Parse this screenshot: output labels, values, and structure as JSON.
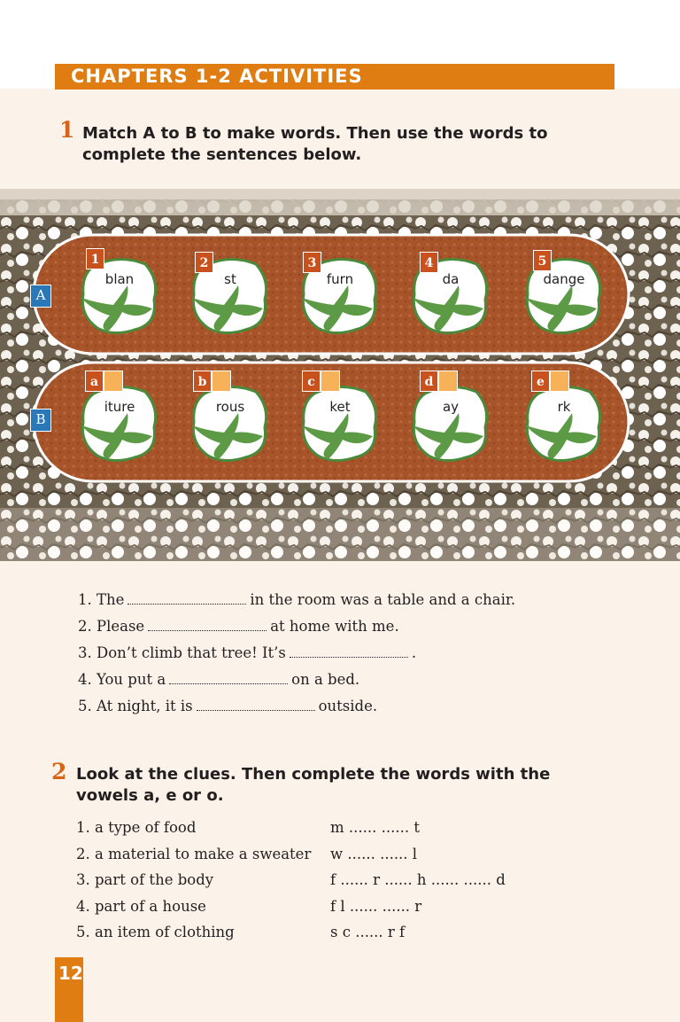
{
  "header": {
    "title": "CHAPTERS 1-2 ACTIVITIES"
  },
  "exercise1": {
    "number": "1",
    "instruction_line1": "Match A to B to make words. Then use the words to",
    "instruction_line2": "complete the sentences below.",
    "row_a_label": "A",
    "row_b_label": "B",
    "row_a": [
      {
        "num": "1",
        "word": "blan"
      },
      {
        "num": "2",
        "word": "st"
      },
      {
        "num": "3",
        "word": "furn"
      },
      {
        "num": "4",
        "word": "da"
      },
      {
        "num": "5",
        "word": "dange"
      }
    ],
    "row_b": [
      {
        "letter": "a",
        "word": "iture"
      },
      {
        "letter": "b",
        "word": "rous"
      },
      {
        "letter": "c",
        "word": "ket"
      },
      {
        "letter": "d",
        "word": "ay"
      },
      {
        "letter": "e",
        "word": "rk"
      }
    ],
    "sentences": [
      {
        "before": "1. The",
        "after": "in the room was a table and a chair."
      },
      {
        "before": "2. Please",
        "after": "at home with me."
      },
      {
        "before": "3. Don’t climb that tree! It’s",
        "after": "."
      },
      {
        "before": "4. You put a",
        "after": "on a bed."
      },
      {
        "before": "5. At night, it is",
        "after": "outside."
      }
    ]
  },
  "exercise2": {
    "number": "2",
    "instruction_line1": "Look at the clues. Then complete the words with the",
    "instruction_line2": "vowels a, e or o.",
    "clues": [
      "1. a type of food",
      "2. a material to make a sweater",
      "3. part of the body",
      "4. part of a house",
      "5. an item of clothing"
    ],
    "word_puzzles": [
      "m ...... ...... t",
      "w ...... ...... l",
      "f ...... r ...... h ...... ...... d",
      "f l ...... ...... r",
      "s c ...... r f"
    ]
  },
  "footer": {
    "page_number": "12"
  }
}
